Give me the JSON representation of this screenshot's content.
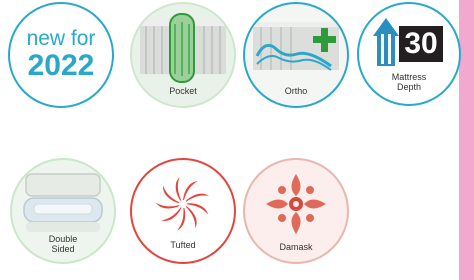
{
  "colors": {
    "accent_blue": "#2aa8c9",
    "tufted_red": "#e2463e",
    "side_stripe": "#f2a8cf"
  },
  "badges": {
    "new": {
      "line1": "new for",
      "line2": "2022"
    },
    "pocket": {
      "label": "Pocket",
      "icon": "pocket-spring-icon"
    },
    "ortho": {
      "label": "Ortho",
      "icon": "ortho-support-icon"
    },
    "depth": {
      "number": "30",
      "label_line1": "Mattress",
      "label_line2": "Depth",
      "icon": "depth-arrow-icon"
    },
    "double": {
      "label_line1": "Double",
      "label_line2": "Sided",
      "icon": "double-sided-icon"
    },
    "tufted": {
      "label": "Tufted",
      "icon": "tufted-swirl-icon"
    },
    "damask": {
      "label": "Damask",
      "icon": "damask-pattern-icon"
    }
  }
}
